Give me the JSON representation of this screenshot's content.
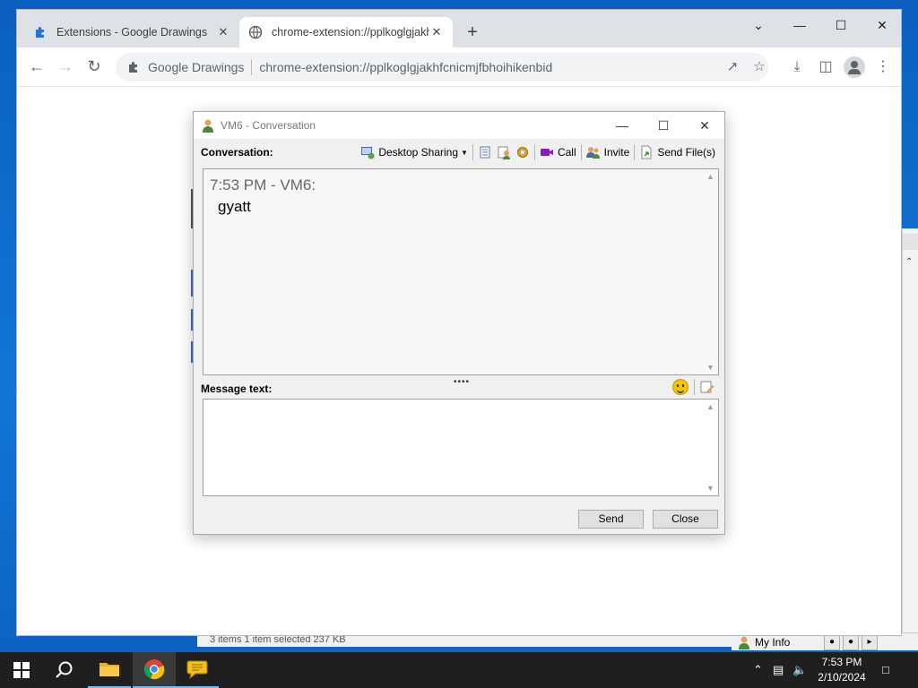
{
  "browser": {
    "tabs": [
      {
        "title": "Extensions - Google Drawings",
        "active": false
      },
      {
        "title": "chrome-extension://pplkoglgjakhfcnicmjfbhoihikenbid",
        "active": true
      }
    ],
    "omnibox": {
      "site_name": "Google Drawings",
      "url": "chrome-extension://pplkoglgjakhfcnicmjfbhoihikenbid"
    }
  },
  "background_app": {
    "status_text": "3 items     1 item selected  237 KB",
    "my_info_label": "My Info"
  },
  "dialog": {
    "title": "VM6 - Conversation",
    "conversation_label": "Conversation:",
    "tools": {
      "desktop_sharing": "Desktop Sharing",
      "call": "Call",
      "invite": "Invite",
      "send_files": "Send File(s)"
    },
    "messages": [
      {
        "header": "7:53 PM - VM6:",
        "text": "gyatt"
      }
    ],
    "message_text_label": "Message text:",
    "message_input_value": "",
    "send_button": "Send",
    "close_button": "Close"
  },
  "taskbar": {
    "time": "7:53 PM",
    "date": "2/10/2024"
  },
  "colors": {
    "desktop": "#1077d6",
    "taskbar": "#1f1f1f",
    "chrome_tabstrip": "#dee1e6",
    "dialog_bg": "#f0f0f0"
  }
}
